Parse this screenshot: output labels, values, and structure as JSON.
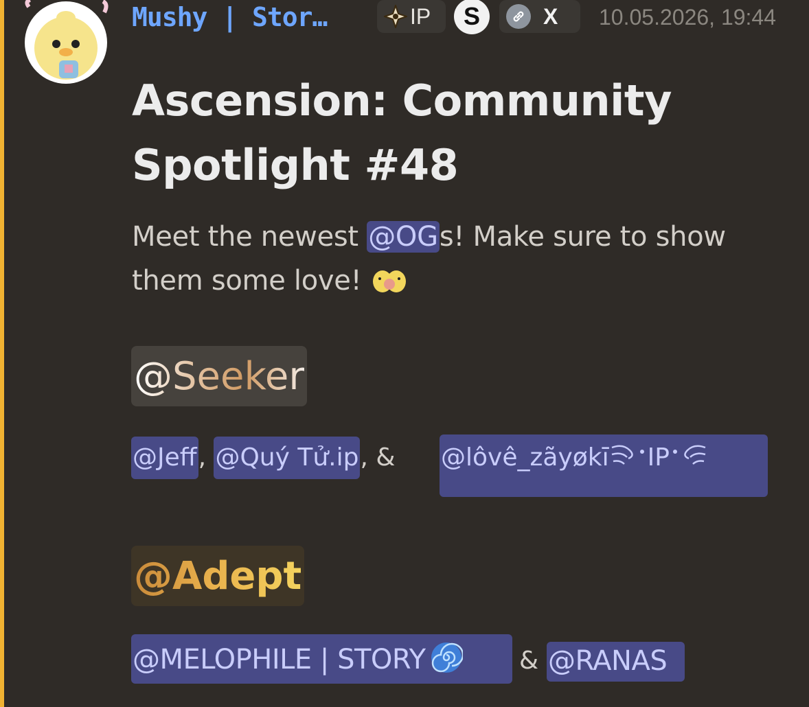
{
  "message": {
    "username": "Mushy | Stor…",
    "badges": {
      "ip_label": "IP",
      "s_label": "S",
      "x_label": "X"
    },
    "timestamp": "10.05.2026, 19:44",
    "heading": "Ascension: Community Spotlight #48",
    "intro": {
      "part1": "Meet the newest ",
      "mention": "@OG",
      "part2": "s! Make sure to show them some love! "
    },
    "roles": [
      {
        "name": "@Seeker",
        "users": [
          "@Jeff",
          "@Quý Tử.ip",
          "@lôvê_zãyøkī"
        ],
        "separators": [
          ", ",
          ", & "
        ],
        "last_suffix": "IP"
      },
      {
        "name": "@Adept",
        "users": [
          "@MELOPHILE | STORY",
          "@RANAS"
        ],
        "separators": [
          " & "
        ]
      }
    ]
  },
  "colors": {
    "background": "#2f2b27",
    "highlight": "#f0b232",
    "mention_bg": "#484a87",
    "mention_text": "#c9cdfb",
    "username": "#6ea6ff"
  },
  "icons": [
    "duck-avatar-icon",
    "sparkle-icon",
    "s-badge-icon",
    "link-icon",
    "duck-emoji-icon",
    "swirl-icon",
    "spiral-icon"
  ]
}
